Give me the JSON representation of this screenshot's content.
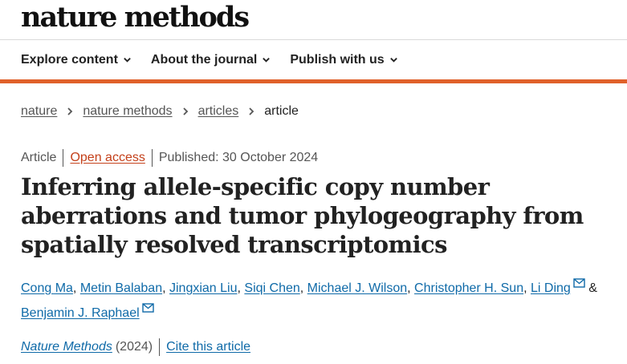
{
  "site": {
    "logo": "nature methods"
  },
  "nav": {
    "items": [
      {
        "label": "Explore content"
      },
      {
        "label": "About the journal"
      },
      {
        "label": "Publish with us"
      }
    ]
  },
  "breadcrumb": {
    "items": [
      "nature",
      "nature methods",
      "articles"
    ],
    "current": "article"
  },
  "meta": {
    "type": "Article",
    "access": "Open access",
    "published": "Published: 30 October 2024"
  },
  "article": {
    "title": "Inferring allele-specific copy number aberrations and tumor phylogeography from spatially resolved transcriptomics",
    "authors": [
      "Cong Ma",
      "Metin Balaban",
      "Jingxian Liu",
      "Siqi Chen",
      "Michael J. Wilson",
      "Christopher H. Sun",
      "Li Ding",
      "Benjamin J. Raphael"
    ],
    "author_separator": ", ",
    "author_conjunction": "&",
    "journal": "Nature Methods",
    "year": "(2024)",
    "cite_label": "Cite this article"
  },
  "colors": {
    "accent": "#e0612a",
    "link": "#0f6aa8",
    "open_access": "#c4401a",
    "text": "#222222",
    "muted": "#555555"
  },
  "icons": [
    "chevron-down-icon",
    "chevron-right-icon",
    "mail-icon"
  ]
}
